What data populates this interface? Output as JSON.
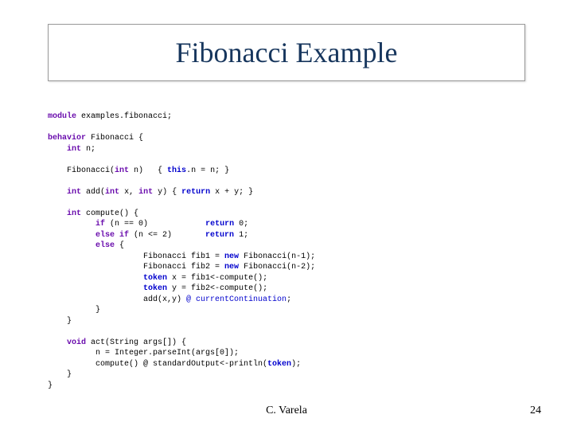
{
  "title": "Fibonacci Example",
  "footer": {
    "author": "C. Varela",
    "page": "24"
  },
  "code": {
    "l01a": "module",
    "l01b": " examples.fibonacci;",
    "l02": "",
    "l03a": "behavior",
    "l03b": " Fibonacci {",
    "l04a": "    ",
    "l04b": "int",
    "l04c": " n;",
    "l05": "",
    "l06a": "    Fibonacci(",
    "l06b": "int",
    "l06c": " n)   { ",
    "l06d": "this",
    "l06e": ".n = n; }",
    "l07": "",
    "l08a": "    ",
    "l08b": "int",
    "l08c": " add(",
    "l08d": "int",
    "l08e": " x, ",
    "l08f": "int",
    "l08g": " y) { ",
    "l08h": "return",
    "l08i": " x + y; }",
    "l09": "",
    "l10a": "    ",
    "l10b": "int",
    "l10c": " compute() {",
    "l11a": "          ",
    "l11b": "if",
    "l11c": " (n == 0)            ",
    "l11d": "return",
    "l11e": " 0;",
    "l12a": "          ",
    "l12b": "else if",
    "l12c": " (n <= 2)       ",
    "l12d": "return",
    "l12e": " 1;",
    "l13a": "          ",
    "l13b": "else",
    "l13c": " {",
    "l14a": "                    Fibonacci fib1 = ",
    "l14b": "new",
    "l14c": " Fibonacci(n-1);",
    "l15a": "                    Fibonacci fib2 = ",
    "l15b": "new",
    "l15c": " Fibonacci(n-2);",
    "l16a": "                    ",
    "l16b": "token",
    "l16c": " x = fib1<-compute();",
    "l17a": "                    ",
    "l17b": "token",
    "l17c": " y = fib2<-compute();",
    "l18a": "                    add(x,y) ",
    "l18b": "@ currentContinuation",
    "l18c": ";",
    "l19": "          }",
    "l20": "    }",
    "l21": "",
    "l22a": "    ",
    "l22b": "void",
    "l22c": " act(String args[]) {",
    "l23": "          n = Integer.parseInt(args[0]);",
    "l24a": "          compute() @ standardOutput<-println(",
    "l24b": "token",
    "l24c": ");",
    "l25": "    }",
    "l26": "}"
  }
}
